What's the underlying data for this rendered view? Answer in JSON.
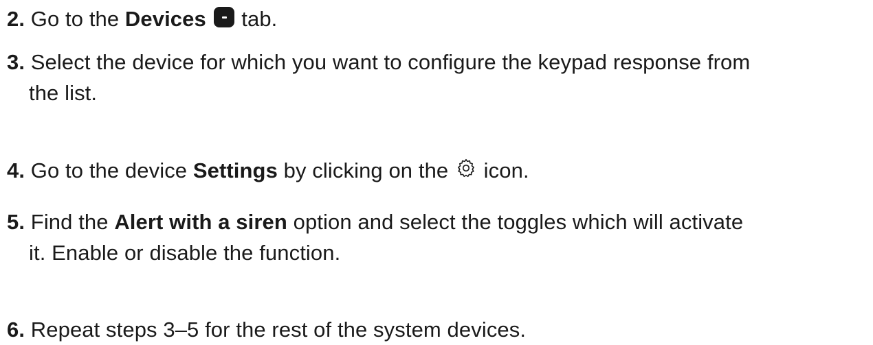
{
  "steps": [
    {
      "number": "2.",
      "pre": "Go to the ",
      "bold": "Devices",
      "icon": "devices-tab-icon",
      "post": " tab."
    },
    {
      "number": "3.",
      "line1": "Select the device for which you want to configure the keypad response from",
      "line2": "the list."
    },
    {
      "number": "4.",
      "pre": "Go to the device ",
      "bold": "Settings",
      "mid": " by clicking on the ",
      "icon": "gear-icon",
      "post": " icon."
    },
    {
      "number": "5.",
      "pre": "Find the ",
      "bold": "Alert with a siren",
      "post": " option and select the toggles which will activate",
      "line2": "it. Enable or disable the function."
    },
    {
      "number": "6.",
      "text": "Repeat steps 3–5 for the rest of the system devices."
    }
  ],
  "colors": {
    "text": "#1a1a1a",
    "background": "#ffffff"
  }
}
